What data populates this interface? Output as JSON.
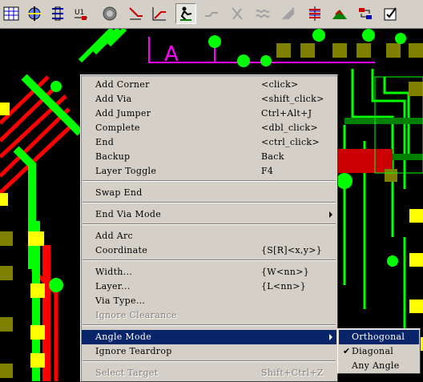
{
  "toolbar": {
    "icons": [
      "grid-icon",
      "mirror-icon",
      "bus-icon",
      "part-ref-icon",
      "via-icon",
      "route-icon",
      "angle-route-icon",
      "interactive-route-icon",
      "shape-icon",
      "shield-icon",
      "wave-icon",
      "tune-icon",
      "layer-stack-icon",
      "copper-icon",
      "swap-icon",
      "check-icon"
    ],
    "labels": {
      "ref": "U1"
    }
  },
  "board": {
    "label": "A",
    "colors": {
      "background": "#000000",
      "trace_green": "#00ff00",
      "trace_red": "#ff0000",
      "pad_yellow": "#ffff00",
      "pad_olive": "#808000",
      "outline_magenta": "#ff00ff",
      "trace_dark_green": "#008000",
      "via_white": "#ffffff"
    }
  },
  "context_menu": {
    "items": [
      {
        "label": "Add Corner",
        "accel": "<click>",
        "disabled": false
      },
      {
        "label": "Add Via",
        "accel": "<shift_click>",
        "disabled": false
      },
      {
        "label": "Add Jumper",
        "accel": "Ctrl+Alt+J",
        "disabled": false
      },
      {
        "label": "Complete",
        "accel": "<dbl_click>",
        "disabled": false
      },
      {
        "label": "End",
        "accel": "<ctrl_click>",
        "disabled": false
      },
      {
        "label": "Backup",
        "accel": "Back",
        "disabled": false
      },
      {
        "label": "Layer Toggle",
        "accel": "F4",
        "disabled": false
      },
      {
        "label": "Swap End",
        "accel": "",
        "disabled": false
      },
      {
        "label": "End Via Mode",
        "accel": "",
        "disabled": false,
        "submenu": true
      },
      {
        "label": "Add Arc",
        "accel": "",
        "disabled": false
      },
      {
        "label": "Coordinate",
        "accel": "{S[R]<x,y>}",
        "disabled": false
      },
      {
        "label": "Width...",
        "accel": "{W<nn>}",
        "disabled": false
      },
      {
        "label": "Layer...",
        "accel": "{L<nn>}",
        "disabled": false
      },
      {
        "label": "Via Type...",
        "accel": "",
        "disabled": false
      },
      {
        "label": "Ignore Clearance",
        "accel": "",
        "disabled": true
      },
      {
        "label": "Angle Mode",
        "accel": "",
        "disabled": false,
        "submenu": true,
        "selected": true
      },
      {
        "label": "Ignore Teardrop",
        "accel": "",
        "disabled": false
      },
      {
        "label": "Select Target",
        "accel": "Shift+Ctrl+Z",
        "disabled": true
      }
    ]
  },
  "angle_submenu": {
    "items": [
      {
        "label": "Orthogonal",
        "checked": false,
        "selected": true
      },
      {
        "label": "Diagonal",
        "checked": true,
        "selected": false
      },
      {
        "label": "Any Angle",
        "checked": false,
        "selected": false
      }
    ],
    "check_glyph": "✔"
  }
}
